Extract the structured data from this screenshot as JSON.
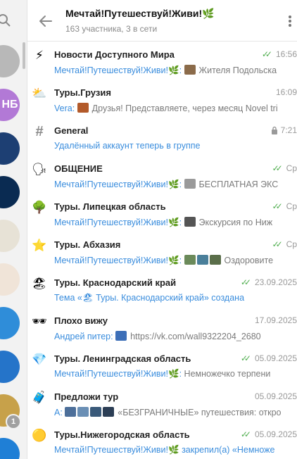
{
  "header": {
    "title": "Мечтай!Путешествуй!Живи!🌿",
    "subtitle": "163 участника, 3 в сети"
  },
  "sidebar": {
    "items": [
      {
        "label": "",
        "color": "#b8b8b8"
      },
      {
        "label": "НБ",
        "color": "#b279d6"
      },
      {
        "label": "",
        "color": "#1d3f73"
      },
      {
        "label": "",
        "color": "#0a2b52"
      },
      {
        "label": "",
        "color": "#e7e2d6"
      },
      {
        "label": "",
        "color": "#f0e4d8"
      },
      {
        "label": "",
        "color": "#2f8dd9"
      },
      {
        "label": "",
        "color": "#2574c9"
      },
      {
        "label": "",
        "color": "#c7a14a"
      },
      {
        "label": "",
        "color": "#1f7fd6"
      }
    ],
    "badge": "1"
  },
  "chats": [
    {
      "icon": "⚡",
      "title": "Новости Доступного Мира",
      "time": "16:56",
      "checks": true,
      "sender": "Мечтай!Путешествуй!Живи!🌿:",
      "text": "Жителя Подольска",
      "thumbs": [
        "#8b6b4a"
      ]
    },
    {
      "icon": "⛅",
      "title": "Туры.Грузия",
      "time": "16:09",
      "checks": false,
      "sender": "Vera:",
      "text": "Друзья! Представляете, через месяц Novel tri",
      "thumbs": [
        "#b35a2a"
      ]
    },
    {
      "icon": "#",
      "title": "General",
      "time": "7:21",
      "checks": false,
      "lock": true,
      "sender": "",
      "text": "Удалённый аккаунт теперь в группе",
      "action": true,
      "thumbs": []
    },
    {
      "icon": "🗣",
      "title": "ОБЩЕНИЕ",
      "time": "Ср",
      "checks": true,
      "sender": "Мечтай!Путешествуй!Живи!🌿:",
      "text": "БЕСПЛАТНАЯ ЭКС",
      "thumbs": [
        "#9a9a9a"
      ]
    },
    {
      "icon": "🌳",
      "title": "Туры. Липецкая область",
      "time": "Ср",
      "checks": true,
      "sender": "Мечтай!Путешествуй!Живи!🌿:",
      "text": "Экскурсия по Ниж",
      "thumbs": [
        "#555555"
      ]
    },
    {
      "icon": "⭐",
      "title": "Туры. Абхазия",
      "time": "Ср",
      "checks": true,
      "sender": "Мечтай!Путешествуй!Живи!🌿:",
      "text": "Оздоровите",
      "thumbs": [
        "#6b8a5a",
        "#4a7f9a",
        "#5a6e4a"
      ]
    },
    {
      "icon": "🏖",
      "title": "Туры. Краснодарский край",
      "time": "23.09.2025",
      "checks": true,
      "sender": "",
      "text": "Тема «🏖 Туры. Краснодарский край» создана",
      "action": true,
      "thumbs": []
    },
    {
      "icon": "🕶",
      "title": "Плохо вижу",
      "time": "17.09.2025",
      "checks": false,
      "sender": "Андрей питер:",
      "text": "https://vk.com/wall9322204_2680",
      "thumbs": [
        "#3d6fb8"
      ]
    },
    {
      "icon": "💎",
      "title": "Туры. Ленинградская область",
      "time": "05.09.2025",
      "checks": true,
      "sender": "Мечтай!Путешествуй!Живи!🌿:",
      "text": "Немножечко терпени",
      "thumbs": []
    },
    {
      "icon": "🧳",
      "title": "Предложи тур",
      "time": "05.09.2025",
      "checks": false,
      "sender": "A:",
      "text": "«БЕЗГРАНИЧНЫЕ» путешествия: откро",
      "thumbs": [
        "#4d6f9a",
        "#6a8fb5",
        "#3a5a7a",
        "#2c3e55"
      ]
    },
    {
      "icon": "🟡",
      "title": "Туры.Нижегородская область",
      "time": "05.09.2025",
      "checks": true,
      "sender": "Мечтай!Путешествуй!Живи!🌿",
      "text": "закрепил(а) «Немноже",
      "pinned": true,
      "thumbs": []
    }
  ]
}
